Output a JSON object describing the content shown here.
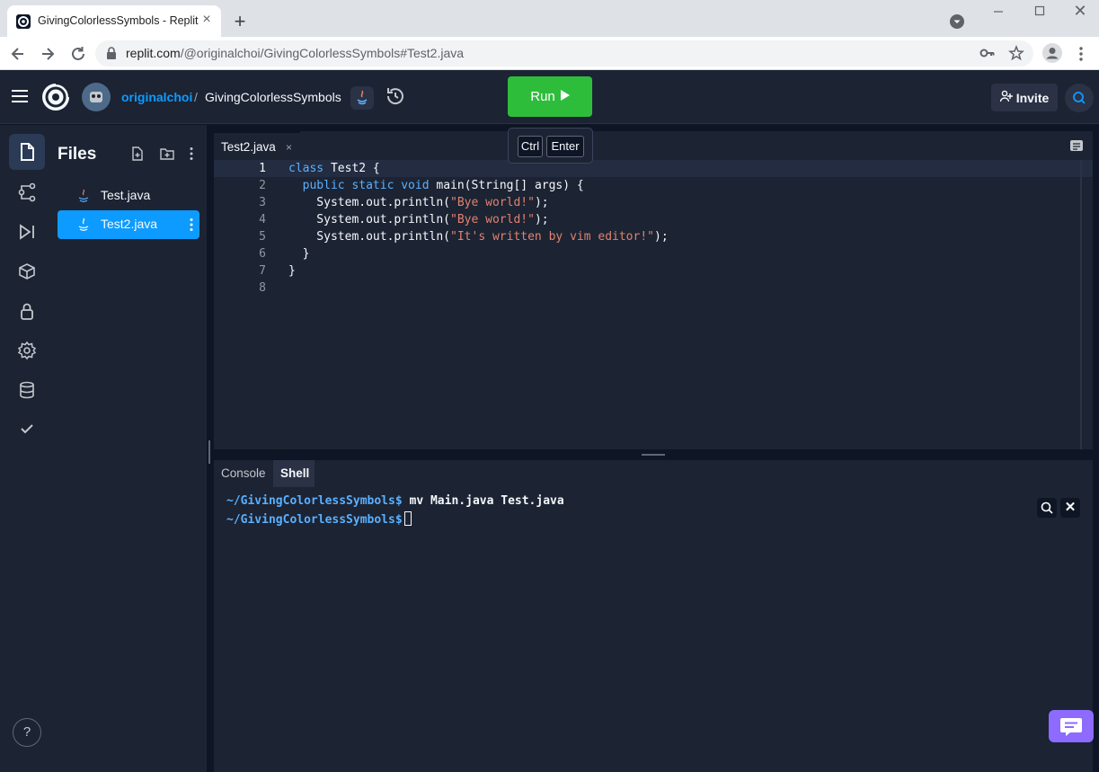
{
  "browser": {
    "tab_title": "GivingColorlessSymbols - Replit",
    "tab_close": "×",
    "new_tab": "+",
    "url_host": "replit.com",
    "url_path": "/@originalchoi/GivingColorlessSymbols#Test2.java",
    "close": "✕"
  },
  "header": {
    "owner": "originalchoi",
    "separator": "/",
    "repl_name": "GivingColorlessSymbols",
    "run_label": "Run",
    "invite_label": "Invite"
  },
  "tooltip": {
    "key1": "Ctrl",
    "key2": "Enter"
  },
  "files": {
    "title": "Files",
    "items": [
      {
        "name": "Test.java"
      },
      {
        "name": "Test2.java"
      }
    ]
  },
  "editor": {
    "tab_label": "Test2.java",
    "tab_close": "×",
    "line_numbers": [
      "1",
      "2",
      "3",
      "4",
      "5",
      "6",
      "7",
      "8"
    ]
  },
  "console": {
    "tab_console": "Console",
    "tab_shell": "Shell",
    "prompt_path": "~/GivingColorlessSymbols$",
    "line1_cmd": " mv Main.java Test.java",
    "close": "✕"
  },
  "help": {
    "label": "?"
  },
  "colors": {
    "run": "#2ebd3b",
    "accent": "#0d9bff",
    "chat": "#8d6bff"
  }
}
